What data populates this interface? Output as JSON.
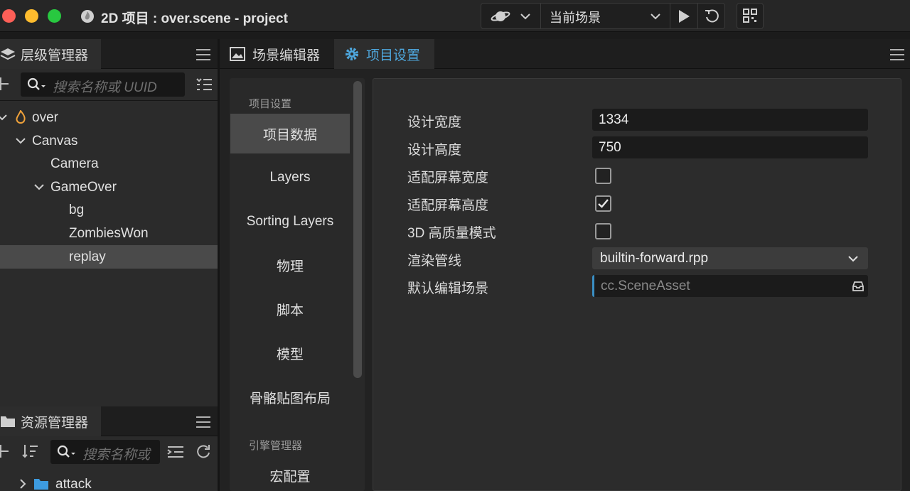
{
  "window": {
    "title": "2D 项目 : over.scene - project"
  },
  "toolbar": {
    "scene_select": "当前场景"
  },
  "hierarchy": {
    "title": "层级管理器",
    "search_placeholder": "搜索名称或 UUID",
    "nodes": [
      {
        "label": "over"
      },
      {
        "label": "Canvas"
      },
      {
        "label": "Camera"
      },
      {
        "label": "GameOver"
      },
      {
        "label": "bg"
      },
      {
        "label": "ZombiesWon"
      },
      {
        "label": "replay"
      }
    ]
  },
  "assets": {
    "title": "资源管理器",
    "search_placeholder": "搜索名称或",
    "items": [
      {
        "label": "attack"
      }
    ]
  },
  "editor_tabs": {
    "scene_editor": "场景编辑器",
    "project_settings": "项目设置"
  },
  "settings_nav": {
    "section_project": "项目设置",
    "items": [
      "项目数据",
      "Layers",
      "Sorting Layers",
      "物理",
      "脚本",
      "模型",
      "骨骼贴图布局"
    ],
    "section_engine": "引擎管理器",
    "engine_items": [
      "宏配置"
    ]
  },
  "project_data": {
    "design_width_label": "设计宽度",
    "design_width": "1334",
    "design_height_label": "设计高度",
    "design_height": "750",
    "fit_width_label": "适配屏幕宽度",
    "fit_width": false,
    "fit_height_label": "适配屏幕高度",
    "fit_height": true,
    "hq_3d_label": "3D 高质量模式",
    "hq_3d": false,
    "pipeline_label": "渲染管线",
    "pipeline": "builtin-forward.rpp",
    "default_scene_label": "默认编辑场景",
    "default_scene": "cc.SceneAsset"
  },
  "colors": {
    "accent_blue": "#3a8fc4",
    "active_tab_text": "#4ea6dc",
    "close": "#fe5f57",
    "minimize": "#febc2e",
    "zoom": "#28c840"
  }
}
